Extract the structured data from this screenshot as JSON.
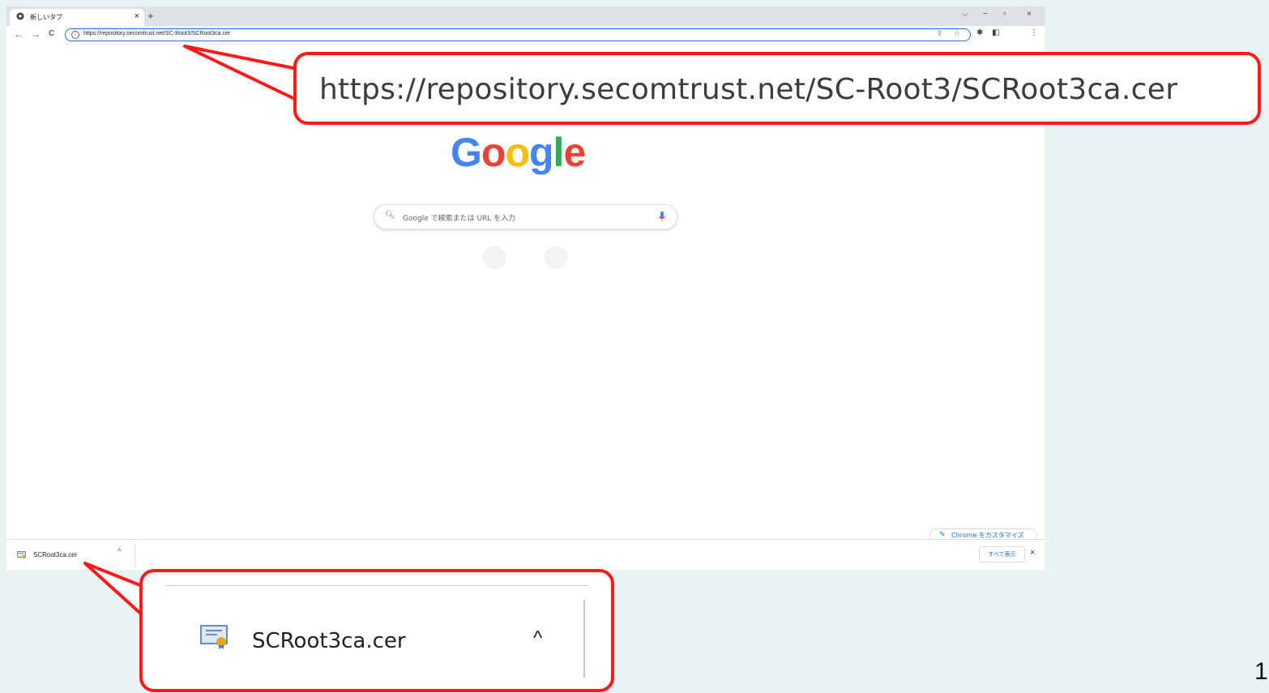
{
  "browser": {
    "tab": {
      "title": "新しいタブ",
      "close": "×"
    },
    "new_tab": "+",
    "window_controls": {
      "tab_search": "⌵",
      "minimize": "−",
      "restore": "▫",
      "close": "×"
    },
    "nav": {
      "back": "←",
      "forward": "→",
      "reload": "C"
    },
    "omnibox": {
      "url": "https://repository.secomtrust.net/SC-Root3/SCRoot3ca.cer"
    },
    "toolbar_icons": {
      "share": "⇪",
      "bookmark": "☆",
      "extensions": "✱",
      "side_panel": "◧",
      "menu": "⋮"
    }
  },
  "newtab_page": {
    "logo": [
      "G",
      "o",
      "o",
      "g",
      "l",
      "e"
    ],
    "logo_colors": [
      "#4285F4",
      "#EA4335",
      "#FBBC05",
      "#4285F4",
      "#34A853",
      "#EA4335"
    ],
    "search_placeholder": "Google で検索または URL を入力",
    "customize_label": "Chrome をカスタマイズ"
  },
  "download_shelf": {
    "filename": "SCRoot3ca.cer",
    "chevron": "^",
    "show_all_label": "すべて表示",
    "close": "×"
  },
  "callouts": {
    "url_text": "https://repository.secomtrust.net/SC-Root3/SCRoot3ca.cer",
    "download_filename": "SCRoot3ca.cer",
    "download_chevron": "^",
    "accent_color": "#ff1a1a"
  },
  "page_number": "1"
}
